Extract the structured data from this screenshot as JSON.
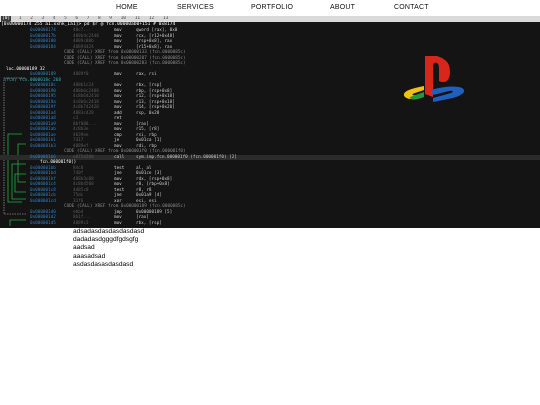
{
  "nav": {
    "items": [
      "HOME",
      "SERVICES",
      "PORTFOLIO",
      "ABOUT",
      "CONTACT"
    ]
  },
  "terminal": {
    "tabs": [
      "[0]",
      "1",
      "2",
      "3",
      "4",
      "5",
      "6",
      "7",
      "8",
      "9",
      "10",
      "11",
      "12",
      "13"
    ],
    "active_tab": 0,
    "status_line": "[0x00000174 255 a1.xxhk_Ia1]> pd $r @ fcn.00000ab0+151 # 0x8174",
    "lines": [
      {
        "kind": "ins",
        "addr": "0x00000174",
        "bytes": "48c7...",
        "mn": "mov",
        "op": "qword [rax], 0x0",
        "color": "blue"
      },
      {
        "kind": "ins",
        "addr": "0x0000017b",
        "bytes": "488b4c2448",
        "mn": "mov",
        "op": "rcx, [r12+0x48]",
        "color": "blue"
      },
      {
        "kind": "ins",
        "addr": "0x00000180",
        "bytes": "4889c88b",
        "mn": "mov",
        "op": "[rsp+0x8], rax",
        "color": "blue"
      },
      {
        "kind": "ins",
        "addr": "0x00000184",
        "bytes": "48894424",
        "mn": "mov",
        "op": "[r15+0x8], rax",
        "color": "blue"
      },
      {
        "kind": "xref",
        "text": "CODE (CALL) XREF from 0x00000133 (fcn.0000085c)"
      },
      {
        "kind": "xref",
        "text": "CODE (CALL) XREF from 0x00000207 (fcn.0000085c)"
      },
      {
        "kind": "xref",
        "text": "CODE (CALL) XREF from 0x00000283 (fcn.0000085c)"
      },
      {
        "kind": "label",
        "text": "loc.00000189 32",
        "color": "white"
      },
      {
        "kind": "ins",
        "addr": "0x00000189",
        "bytes": "4889f0",
        "mn": "mov",
        "op": "rax, rsi",
        "color": "blue"
      },
      {
        "kind": "label",
        "text": "(fcn) fcn.0000018c 268",
        "color": "cyan"
      },
      {
        "kind": "ins",
        "addr": "0x0000018c",
        "bytes": "488b1c24",
        "mn": "mov",
        "op": "rbx, [rsp]",
        "color": "blue"
      },
      {
        "kind": "ins",
        "addr": "0x00000190",
        "bytes": "488b6c2408",
        "mn": "mov",
        "op": "rbp, [rsp+0x8]",
        "color": "blue"
      },
      {
        "kind": "ins",
        "addr": "0x00000195",
        "bytes": "4c8b642410",
        "mn": "mov",
        "op": "r12, [rsp+0x10]",
        "color": "blue"
      },
      {
        "kind": "ins",
        "addr": "0x0000019a",
        "bytes": "4c8b6c2418",
        "mn": "mov",
        "op": "r13, [rsp+0x18]",
        "color": "blue"
      },
      {
        "kind": "ins",
        "addr": "0x0000019f",
        "bytes": "4c8b742420",
        "mn": "mov",
        "op": "r14, [rsp+0x20]",
        "color": "blue"
      },
      {
        "kind": "ins",
        "addr": "0x000001a4",
        "bytes": "4883c428",
        "mn": "add",
        "op": "rsp, 0x28",
        "color": "blue"
      },
      {
        "kind": "ins",
        "addr": "0x000001a8",
        "bytes": "c3",
        "mn": "ret",
        "op": "",
        "color": "red"
      },
      {
        "kind": "ins",
        "addr": "0x000001a9",
        "bytes": "8bf088...",
        "mn": "mov",
        "op": "[rax]",
        "color": "blue"
      },
      {
        "kind": "ins",
        "addr": "0x000001ab",
        "bytes": "4c8b3e",
        "mn": "mov",
        "op": "r15, [r8]",
        "color": "blue"
      },
      {
        "kind": "ins",
        "addr": "0x000001ae",
        "bytes": "4839ee",
        "mn": "cmp",
        "op": "rsi, rbp",
        "color": "blue"
      },
      {
        "kind": "ins",
        "addr": "0x000001b1",
        "bytes": "7417",
        "mn": "je",
        "op": "0x01ca [1]",
        "color": "green"
      },
      {
        "kind": "ins",
        "addr": "0x000001b3",
        "bytes": "4889ef",
        "mn": "mov",
        "op": "rdi, rbp",
        "color": "blue"
      },
      {
        "kind": "xref",
        "text": "CODE (CALL) XREF from 0x000001f0 (fcn.000001f0)"
      },
      {
        "kind": "call",
        "addr": "0x000001b6",
        "bytes": "e8754200",
        "mn": "call",
        "op": "sym.imp.fcn.000001f0 (fcn.000001f0) [2]"
      },
      {
        "kind": "label",
        "text": "fcn.000001f0()",
        "color": "white"
      },
      {
        "kind": "ins",
        "addr": "0x000001bb",
        "bytes": "84c0",
        "mn": "test",
        "op": "al, al",
        "color": "blue"
      },
      {
        "kind": "ins",
        "addr": "0x000001bd",
        "bytes": "740f",
        "mn": "jne",
        "op": "0x01ce [3]",
        "color": "green"
      },
      {
        "kind": "ins",
        "addr": "0x000001bf",
        "bytes": "488b3c08",
        "mn": "mov",
        "op": "rdx, [rsp+0x8]",
        "color": "blue"
      },
      {
        "kind": "ins",
        "addr": "0x000001c4",
        "bytes": "4c8b4508",
        "mn": "mov",
        "op": "r8, [rbp+0x8]",
        "color": "blue"
      },
      {
        "kind": "ins",
        "addr": "0x000001c8",
        "bytes": "4d85c0",
        "mn": "test",
        "op": "r8, r8",
        "color": "blue"
      },
      {
        "kind": "ins",
        "addr": "0x000001cb",
        "bytes": "75dc",
        "mn": "jne",
        "op": "0x01a9 [4]",
        "color": "green"
      },
      {
        "kind": "ins",
        "addr": "0x000001cd",
        "bytes": "31f6",
        "mn": "xor",
        "op": "esi, esi",
        "color": "blue"
      },
      {
        "kind": "xref",
        "text": "CODE (CALL) XREF from 0x00000189 (fcn.0000085c)"
      },
      {
        "kind": "ins",
        "addr": "0x000001d0",
        "bytes": "ebb4",
        "mn": "jmp",
        "op": "0x00000189 [5]",
        "color": "green"
      },
      {
        "kind": "ins",
        "addr": "0x000001d2",
        "bytes": "8b1f...",
        "mn": "mov",
        "op": "[rax]",
        "color": "blue"
      },
      {
        "kind": "ins",
        "addr": "0x000001d5",
        "bytes": "4889c3",
        "mn": "mov",
        "op": "rbx, [rsp]",
        "color": "blue"
      }
    ]
  },
  "text_items": [
    "adsadasdasdasdasdasd",
    "dadadasdgggdfgdsgfg",
    "aadsad",
    "aaasadsad",
    "asdasdasasdasdasd"
  ],
  "colors": {
    "terminal_bg": "#141414",
    "address_blue": "#2f7fc6",
    "jump_green": "#1fae3f",
    "ret_red": "#d23a3a",
    "logo_red": "#d9261c",
    "logo_blue": "#1f5fbd",
    "logo_yellow": "#f2c10d",
    "logo_green": "#1e9a3a"
  },
  "icons": {
    "logo": "playstation-logo-icon"
  }
}
